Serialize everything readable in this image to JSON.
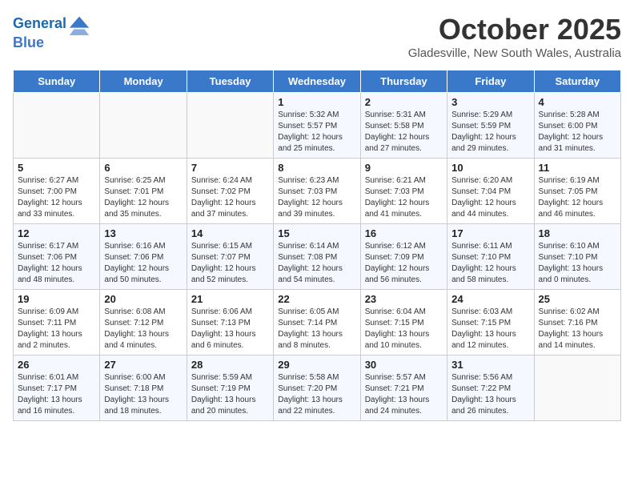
{
  "header": {
    "logo_line1": "General",
    "logo_line2": "Blue",
    "month": "October 2025",
    "location": "Gladesville, New South Wales, Australia"
  },
  "days_of_week": [
    "Sunday",
    "Monday",
    "Tuesday",
    "Wednesday",
    "Thursday",
    "Friday",
    "Saturday"
  ],
  "weeks": [
    [
      {
        "day": "",
        "info": ""
      },
      {
        "day": "",
        "info": ""
      },
      {
        "day": "",
        "info": ""
      },
      {
        "day": "1",
        "info": "Sunrise: 5:32 AM\nSunset: 5:57 PM\nDaylight: 12 hours\nand 25 minutes."
      },
      {
        "day": "2",
        "info": "Sunrise: 5:31 AM\nSunset: 5:58 PM\nDaylight: 12 hours\nand 27 minutes."
      },
      {
        "day": "3",
        "info": "Sunrise: 5:29 AM\nSunset: 5:59 PM\nDaylight: 12 hours\nand 29 minutes."
      },
      {
        "day": "4",
        "info": "Sunrise: 5:28 AM\nSunset: 6:00 PM\nDaylight: 12 hours\nand 31 minutes."
      }
    ],
    [
      {
        "day": "5",
        "info": "Sunrise: 6:27 AM\nSunset: 7:00 PM\nDaylight: 12 hours\nand 33 minutes."
      },
      {
        "day": "6",
        "info": "Sunrise: 6:25 AM\nSunset: 7:01 PM\nDaylight: 12 hours\nand 35 minutes."
      },
      {
        "day": "7",
        "info": "Sunrise: 6:24 AM\nSunset: 7:02 PM\nDaylight: 12 hours\nand 37 minutes."
      },
      {
        "day": "8",
        "info": "Sunrise: 6:23 AM\nSunset: 7:03 PM\nDaylight: 12 hours\nand 39 minutes."
      },
      {
        "day": "9",
        "info": "Sunrise: 6:21 AM\nSunset: 7:03 PM\nDaylight: 12 hours\nand 41 minutes."
      },
      {
        "day": "10",
        "info": "Sunrise: 6:20 AM\nSunset: 7:04 PM\nDaylight: 12 hours\nand 44 minutes."
      },
      {
        "day": "11",
        "info": "Sunrise: 6:19 AM\nSunset: 7:05 PM\nDaylight: 12 hours\nand 46 minutes."
      }
    ],
    [
      {
        "day": "12",
        "info": "Sunrise: 6:17 AM\nSunset: 7:06 PM\nDaylight: 12 hours\nand 48 minutes."
      },
      {
        "day": "13",
        "info": "Sunrise: 6:16 AM\nSunset: 7:06 PM\nDaylight: 12 hours\nand 50 minutes."
      },
      {
        "day": "14",
        "info": "Sunrise: 6:15 AM\nSunset: 7:07 PM\nDaylight: 12 hours\nand 52 minutes."
      },
      {
        "day": "15",
        "info": "Sunrise: 6:14 AM\nSunset: 7:08 PM\nDaylight: 12 hours\nand 54 minutes."
      },
      {
        "day": "16",
        "info": "Sunrise: 6:12 AM\nSunset: 7:09 PM\nDaylight: 12 hours\nand 56 minutes."
      },
      {
        "day": "17",
        "info": "Sunrise: 6:11 AM\nSunset: 7:10 PM\nDaylight: 12 hours\nand 58 minutes."
      },
      {
        "day": "18",
        "info": "Sunrise: 6:10 AM\nSunset: 7:10 PM\nDaylight: 13 hours\nand 0 minutes."
      }
    ],
    [
      {
        "day": "19",
        "info": "Sunrise: 6:09 AM\nSunset: 7:11 PM\nDaylight: 13 hours\nand 2 minutes."
      },
      {
        "day": "20",
        "info": "Sunrise: 6:08 AM\nSunset: 7:12 PM\nDaylight: 13 hours\nand 4 minutes."
      },
      {
        "day": "21",
        "info": "Sunrise: 6:06 AM\nSunset: 7:13 PM\nDaylight: 13 hours\nand 6 minutes."
      },
      {
        "day": "22",
        "info": "Sunrise: 6:05 AM\nSunset: 7:14 PM\nDaylight: 13 hours\nand 8 minutes."
      },
      {
        "day": "23",
        "info": "Sunrise: 6:04 AM\nSunset: 7:15 PM\nDaylight: 13 hours\nand 10 minutes."
      },
      {
        "day": "24",
        "info": "Sunrise: 6:03 AM\nSunset: 7:15 PM\nDaylight: 13 hours\nand 12 minutes."
      },
      {
        "day": "25",
        "info": "Sunrise: 6:02 AM\nSunset: 7:16 PM\nDaylight: 13 hours\nand 14 minutes."
      }
    ],
    [
      {
        "day": "26",
        "info": "Sunrise: 6:01 AM\nSunset: 7:17 PM\nDaylight: 13 hours\nand 16 minutes."
      },
      {
        "day": "27",
        "info": "Sunrise: 6:00 AM\nSunset: 7:18 PM\nDaylight: 13 hours\nand 18 minutes."
      },
      {
        "day": "28",
        "info": "Sunrise: 5:59 AM\nSunset: 7:19 PM\nDaylight: 13 hours\nand 20 minutes."
      },
      {
        "day": "29",
        "info": "Sunrise: 5:58 AM\nSunset: 7:20 PM\nDaylight: 13 hours\nand 22 minutes."
      },
      {
        "day": "30",
        "info": "Sunrise: 5:57 AM\nSunset: 7:21 PM\nDaylight: 13 hours\nand 24 minutes."
      },
      {
        "day": "31",
        "info": "Sunrise: 5:56 AM\nSunset: 7:22 PM\nDaylight: 13 hours\nand 26 minutes."
      },
      {
        "day": "",
        "info": ""
      }
    ]
  ]
}
